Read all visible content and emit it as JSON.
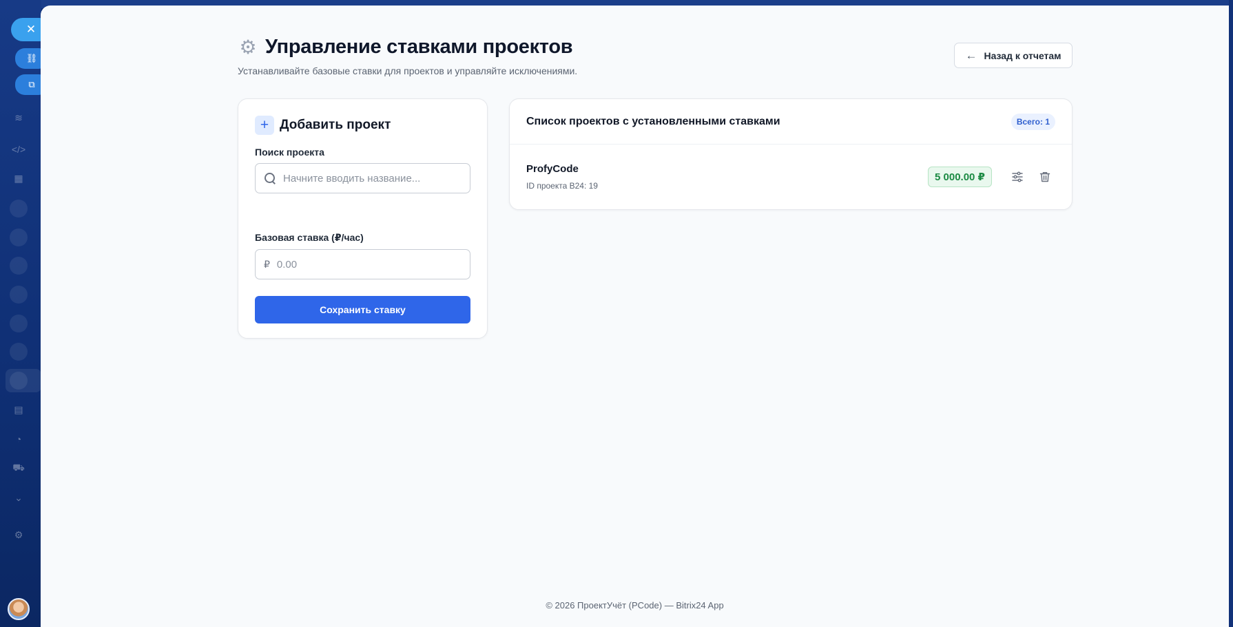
{
  "page": {
    "title": "Управление ставками проектов",
    "subtitle": "Устанавливайте базовые ставки для проектов и управляйте исключениями.",
    "back_label": "Назад к отчетам"
  },
  "add_form": {
    "title": "Добавить проект",
    "search_label": "Поиск проекта",
    "search_placeholder": "Начните вводить название...",
    "rate_label": "Базовая ставка (₽/час)",
    "currency_symbol": "₽",
    "rate_placeholder": "0.00",
    "save_label": "Сохранить ставку"
  },
  "project_list": {
    "title": "Список проектов с установленными ставками",
    "total_label": "Всего: 1",
    "items": [
      {
        "name": "ProfyCode",
        "id_text": "ID проекта B24: 19",
        "rate": "5 000.00 ₽"
      }
    ]
  },
  "footer": {
    "text": "© 2026 ПроектУчёт (PCode) — Bitrix24 App"
  },
  "colors": {
    "accent": "#2f66e9",
    "rate_badge_bg": "#e9f8ee",
    "rate_badge_text": "#1b8a43",
    "portal_bg": "#0d2a6e"
  },
  "icons": {
    "title": "gear-icon",
    "back": "arrow-left-icon",
    "add": "plus-icon",
    "search": "search-icon",
    "row_settings": "sliders-icon",
    "row_delete": "trash-icon"
  }
}
